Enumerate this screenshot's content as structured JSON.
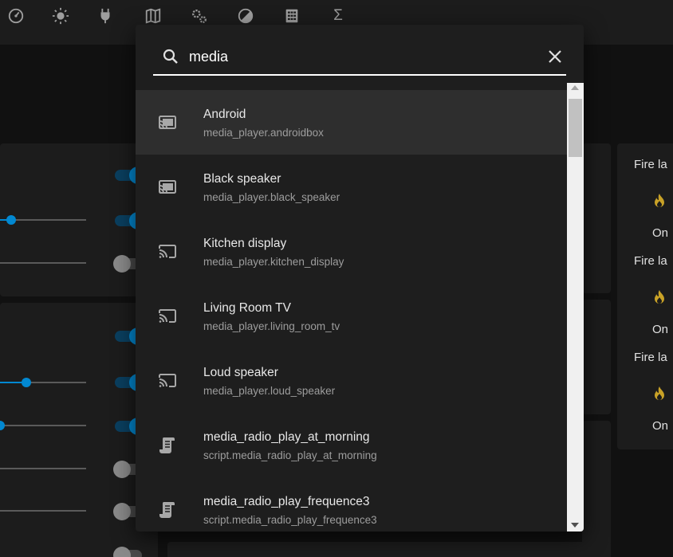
{
  "toolbar": {
    "icons": [
      "gauge-icon",
      "sun-icon",
      "plug-icon",
      "map-icon",
      "cogs-icon",
      "theme-icon",
      "calculator-icon",
      "sigma-icon"
    ],
    "sigma_glyph": "Σ"
  },
  "search": {
    "value": "media",
    "placeholder": ""
  },
  "results": [
    {
      "title": "Android",
      "subtitle": "media_player.androidbox",
      "icon": "cast-connected-icon",
      "selected": true
    },
    {
      "title": "Black speaker",
      "subtitle": "media_player.black_speaker",
      "icon": "cast-connected-icon",
      "selected": false
    },
    {
      "title": "Kitchen display",
      "subtitle": "media_player.kitchen_display",
      "icon": "cast-icon",
      "selected": false
    },
    {
      "title": "Living Room TV",
      "subtitle": "media_player.living_room_tv",
      "icon": "cast-icon",
      "selected": false
    },
    {
      "title": "Loud speaker",
      "subtitle": "media_player.loud_speaker",
      "icon": "cast-icon",
      "selected": false
    },
    {
      "title": "media_radio_play_at_morning",
      "subtitle": "script.media_radio_play_at_morning",
      "icon": "script-icon",
      "selected": false
    },
    {
      "title": "media_radio_play_frequence3",
      "subtitle": "script.media_radio_play_frequence3",
      "icon": "script-icon",
      "selected": false
    }
  ],
  "side_panel": {
    "entities": [
      {
        "label": "Fire la",
        "state": "On"
      },
      {
        "label": "Fire la",
        "state": "On"
      },
      {
        "label": "Fire la",
        "state": "On"
      }
    ]
  },
  "colors": {
    "accent": "#0288d1",
    "flame": "#c9a227",
    "dialog_bg": "#1e1e1e",
    "selected_row": "#2e2e2e"
  }
}
